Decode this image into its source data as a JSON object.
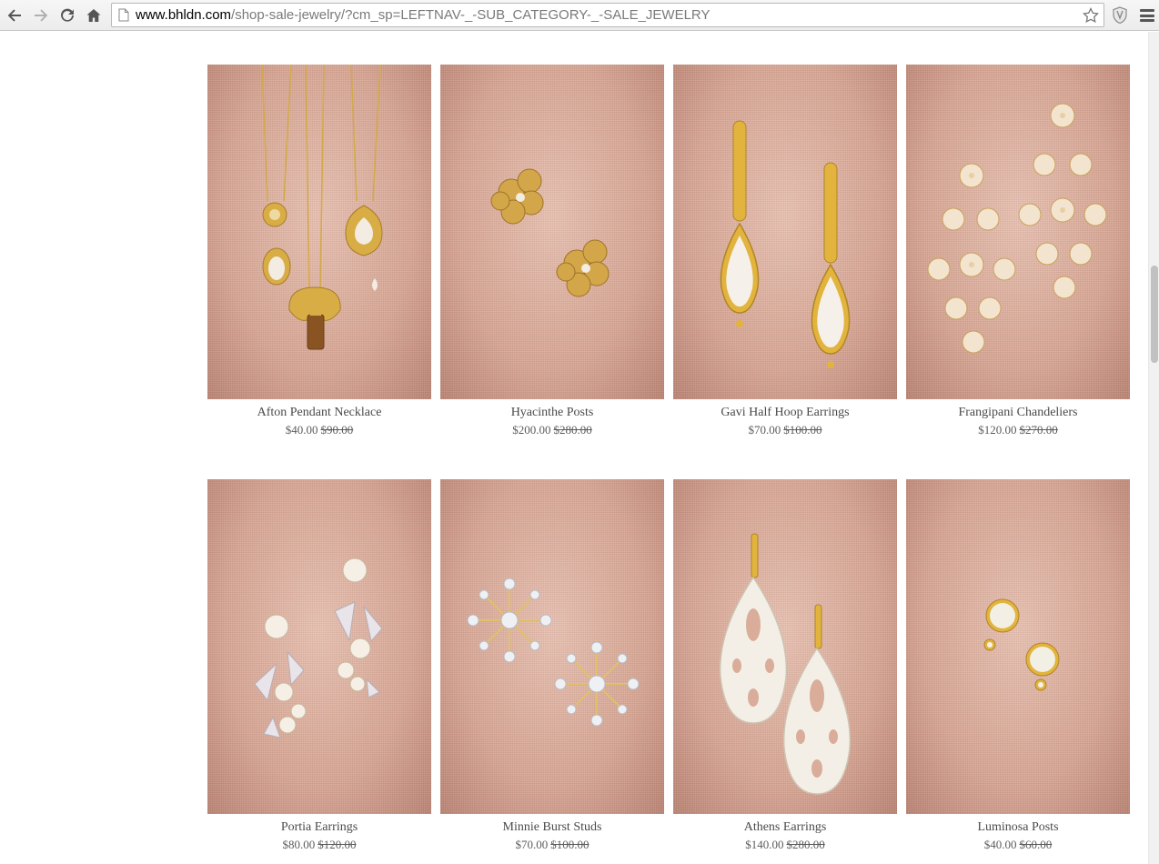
{
  "browser": {
    "url_host": "www.bhldn.com",
    "url_path": "/shop-sale-jewelry/?cm_sp=LEFTNAV-_-SUB_CATEGORY-_-SALE_JEWELRY",
    "icons": [
      "back-icon",
      "forward-icon",
      "reload-icon",
      "home-icon",
      "page-icon",
      "bookmark-star-icon",
      "extension-shield-icon",
      "chrome-menu-icon"
    ]
  },
  "products": [
    {
      "name": "Afton Pendant Necklace",
      "sale_price": "$40.00",
      "original_price": "$90.00"
    },
    {
      "name": "Hyacinthe Posts",
      "sale_price": "$200.00",
      "original_price": "$280.00"
    },
    {
      "name": "Gavi Half Hoop Earrings",
      "sale_price": "$70.00",
      "original_price": "$100.00"
    },
    {
      "name": "Frangipani Chandeliers",
      "sale_price": "$120.00",
      "original_price": "$270.00"
    },
    {
      "name": "Portia Earrings",
      "sale_price": "$80.00",
      "original_price": "$120.00"
    },
    {
      "name": "Minnie Burst Studs",
      "sale_price": "$70.00",
      "original_price": "$100.00"
    },
    {
      "name": "Athens Earrings",
      "sale_price": "$140.00",
      "original_price": "$280.00"
    },
    {
      "name": "Luminosa Posts",
      "sale_price": "$40.00",
      "original_price": "$60.00"
    }
  ],
  "colors": {
    "photo_background": "#d8a593",
    "gold": "#d9ad45",
    "pearl": "#f3ece2",
    "text": "#4a4a4a"
  }
}
